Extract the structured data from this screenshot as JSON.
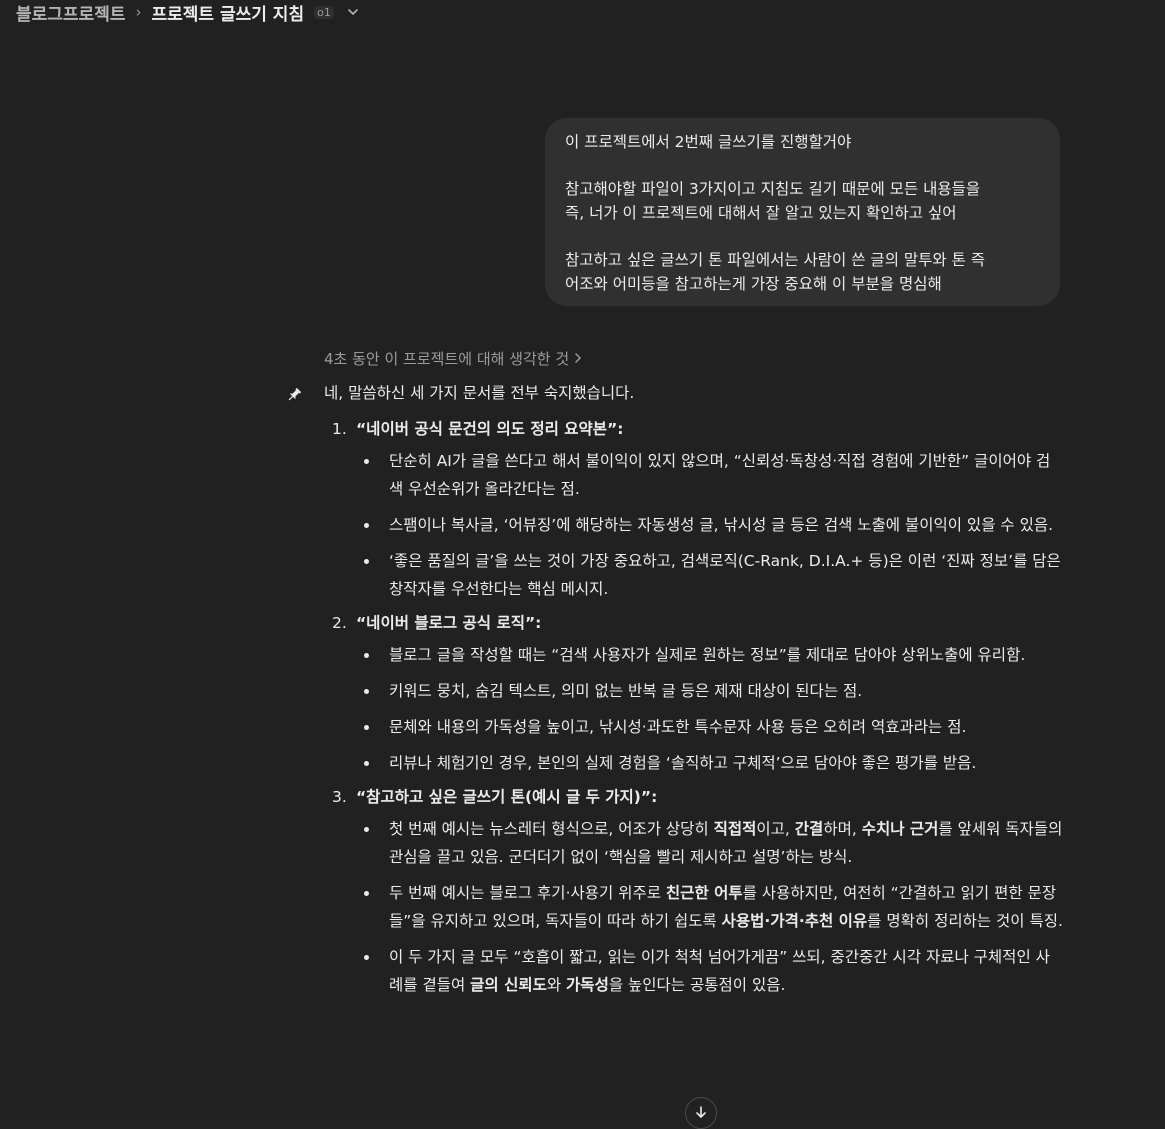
{
  "header": {
    "project": "블로그프로젝트",
    "separator": "›",
    "chat_title": "프로젝트 글쓰기 지침",
    "model_badge": "o1"
  },
  "user_message": {
    "para1": "이 프로젝트에서 2번째 글쓰기를 진행할거야",
    "para2": "참고해야할 파일이 3가지이고 지침도 길기 때문에 모든 내용들을\n즉, 너가 이 프로젝트에 대해서 잘 알고 있는지 확인하고 싶어",
    "para3": "참고하고 싶은 글쓰기 톤 파일에서는 사람이 쓴 글의 말투와 톤 즉\n어조와 어미등을 참고하는게 가장 중요해 이 부분을 명심해"
  },
  "assistant": {
    "thought_label": "4초 동안 이 프로젝트에 대해 생각한 것",
    "intro": "네, 말씀하신 세 가지 문서를 전부 숙지했습니다.",
    "sections": [
      {
        "num": "1.",
        "title": "“네이버 공식 문건의 의도 정리 요약본”:",
        "bullets": [
          [
            "단순히 AI가 글을 쓴다고 해서 불이익이 있지 않으며, “신뢰성·독창성·직접 경험에 기반한” 글이어야 검색 우선순위가 올라간다는 점."
          ],
          [
            "스팸이나 복사글, ‘어뷰징’에 해당하는 자동생성 글, 낚시성 글 등은 검색 노출에 불이익이 있을 수 있음."
          ],
          [
            "‘좋은 품질의 글’을 쓰는 것이 가장 중요하고, 검색로직(C-Rank, D.I.A.+ 등)은 이런 ‘진짜 정보’를 담은 창작자를 우선한다는 핵심 메시지."
          ]
        ]
      },
      {
        "num": "2.",
        "title": "“네이버 블로그 공식 로직”:",
        "bullets": [
          [
            "블로그 글을 작성할 때는 “검색 사용자가 실제로 원하는 정보”를 제대로 담아야 상위노출에 유리함."
          ],
          [
            "키워드 뭉치, 숨김 텍스트, 의미 없는 반복 글 등은 제재 대상이 된다는 점."
          ],
          [
            "문체와 내용의 가독성을 높이고, 낚시성·과도한 특수문자 사용 등은 오히려 역효과라는 점."
          ],
          [
            "리뷰나 체험기인 경우, 본인의 실제 경험을 ‘솔직하고 구체적’으로 담아야 좋은 평가를 받음."
          ]
        ]
      },
      {
        "num": "3.",
        "title": "“참고하고 싶은 글쓰기 톤(예시 글 두 가지)”:",
        "bullets": [
          [
            "첫 번째 예시는 뉴스레터 형식으로, 어조가 상당히 ",
            "직접적",
            "이고, ",
            "간결",
            "하며, ",
            "수치나 근거",
            "를 앞세워 독자들의 관심을 끌고 있음. 군더더기 없이 ‘핵심을 빨리 제시하고 설명’하는 방식."
          ],
          [
            "두 번째 예시는 블로그 후기·사용기 위주로 ",
            "친근한 어투",
            "를 사용하지만, 여전히 “간결하고 읽기 편한 문장들”을 유지하고 있으며, 독자들이 따라 하기 쉽도록 ",
            "사용법·가격·추천 이유",
            "를 명확히 정리하는 것이 특징."
          ],
          [
            "이 두 가지 글 모두 “호흡이 짧고, 읽는 이가 척척 넘어가게끔” 쓰되, 중간중간 시각 자료나 구체적인 사례를 곁들여 ",
            "글의 신뢰도",
            "와 ",
            "가독성",
            "을 높인다는 공통점이 있음."
          ]
        ]
      }
    ]
  },
  "icons": {
    "chevron": "chevron-down-icon",
    "pin": "pin-icon",
    "scroll": "arrow-down-icon"
  },
  "colors": {
    "background": "#212121",
    "bubble": "#303030",
    "text": "#ececec",
    "muted": "#9b9b9b"
  }
}
